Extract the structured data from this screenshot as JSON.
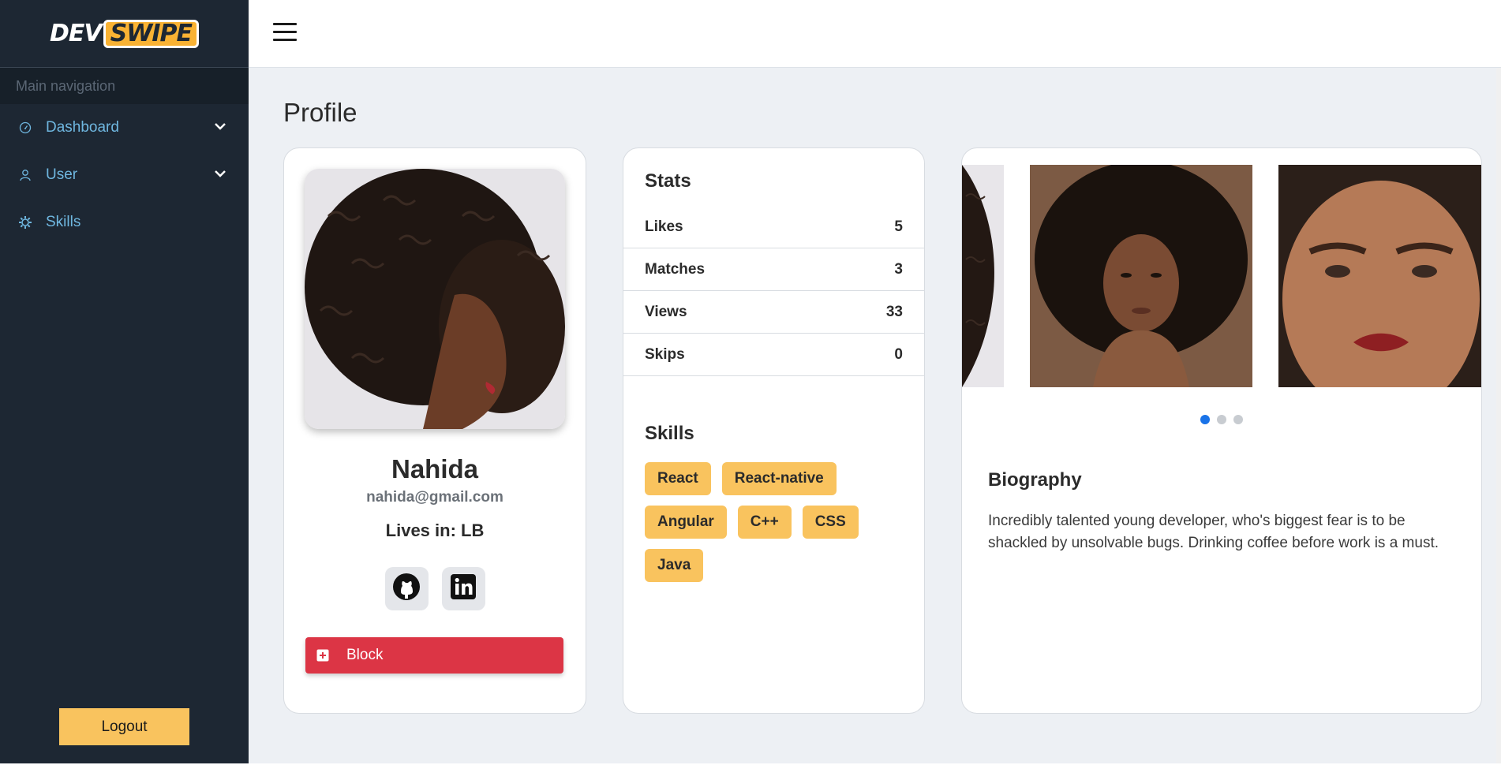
{
  "app": {
    "logo_dev": "DEV",
    "logo_swipe": "SWIPE"
  },
  "sidebar": {
    "header": "Main navigation",
    "items": [
      {
        "label": "Dashboard",
        "icon": "speedometer-icon",
        "expandable": true
      },
      {
        "label": "User",
        "icon": "user-icon",
        "expandable": true
      },
      {
        "label": "Skills",
        "icon": "gear-icon",
        "expandable": false
      }
    ],
    "logout_label": "Logout"
  },
  "page": {
    "title": "Profile"
  },
  "profile": {
    "name": "Nahida",
    "email": "nahida@gmail.com",
    "lives_in": "Lives in: LB",
    "socials": [
      {
        "name": "github",
        "icon": "github-icon"
      },
      {
        "name": "linkedin",
        "icon": "linkedin-icon"
      }
    ],
    "block_label": "Block"
  },
  "stats": {
    "title": "Stats",
    "rows": [
      {
        "label": "Likes",
        "value": "5"
      },
      {
        "label": "Matches",
        "value": "3"
      },
      {
        "label": "Views",
        "value": "33"
      },
      {
        "label": "Skips",
        "value": "0"
      }
    ]
  },
  "skills": {
    "title": "Skills",
    "items": [
      "React",
      "React-native",
      "Angular",
      "C++",
      "CSS",
      "Java"
    ]
  },
  "carousel": {
    "active_index": 0,
    "count": 3
  },
  "biography": {
    "title": "Biography",
    "text": "Incredibly talented young developer, who's biggest fear is to be shackled by unsolvable bugs. Drinking coffee before work is a must."
  },
  "colors": {
    "sidebar_bg": "#1d2733",
    "nav_text": "#6fb7e0",
    "accent_yellow": "#f9c35e",
    "danger_red": "#dc3545",
    "carousel_active": "#1a73e8"
  }
}
